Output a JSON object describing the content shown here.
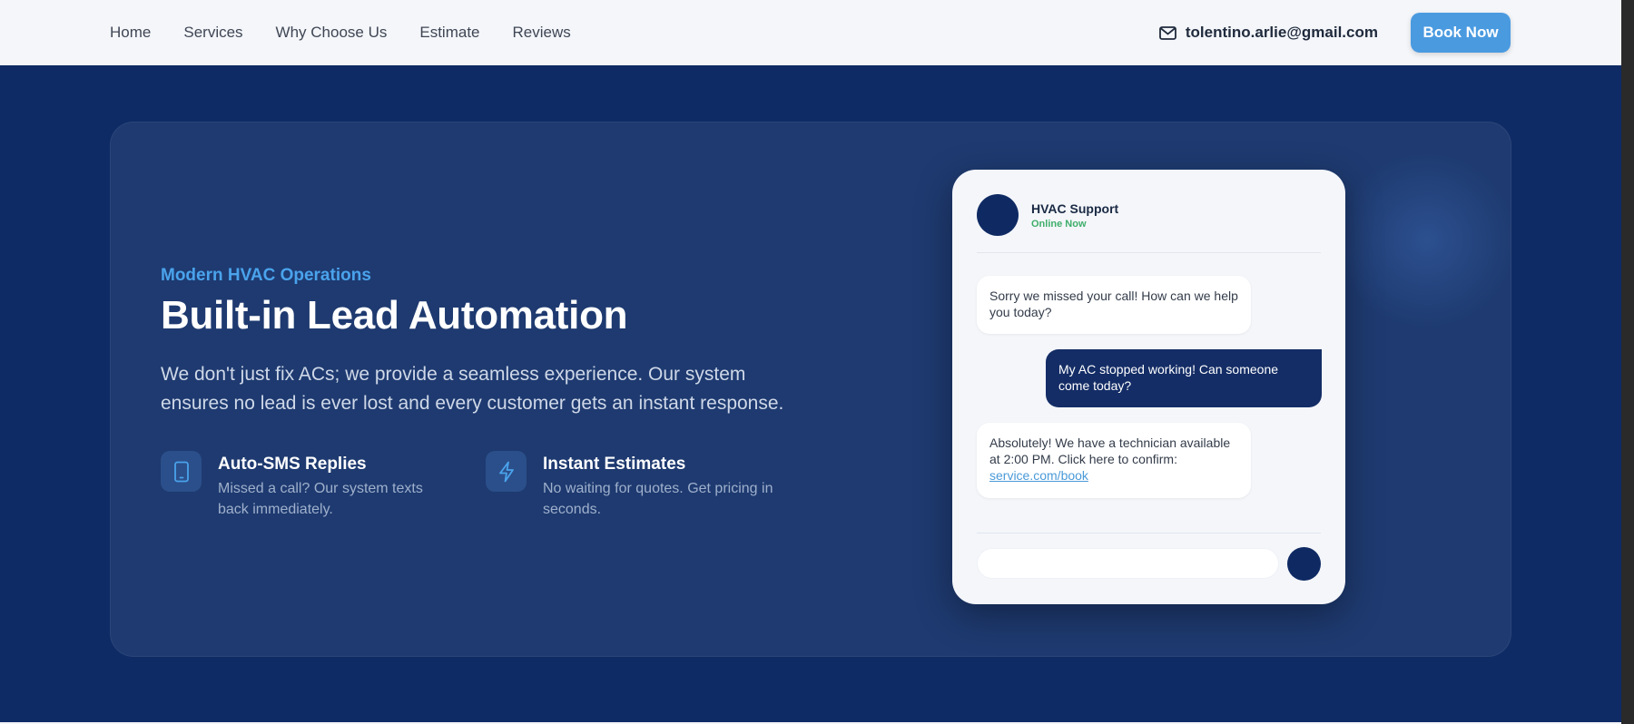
{
  "nav": {
    "links": [
      "Home",
      "Services",
      "Why Choose Us",
      "Estimate",
      "Reviews"
    ],
    "email": "tolentino.arlie@gmail.com",
    "book_label": "Book Now"
  },
  "hero": {
    "eyebrow": "Modern HVAC Operations",
    "headline": "Built-in Lead Automation",
    "description": "We don't just fix ACs; we provide a seamless experience. Our system ensures no lead is ever lost and every customer gets an instant response.",
    "features": [
      {
        "icon": "smartphone-icon",
        "title": "Auto-SMS Replies",
        "text": "Missed a call? Our system texts back immediately."
      },
      {
        "icon": "lightning-icon",
        "title": "Instant Estimates",
        "text": "No waiting for quotes. Get pricing in seconds."
      }
    ]
  },
  "chat": {
    "agent_name": "HVAC Support",
    "agent_status": "Online Now",
    "messages": [
      {
        "from": "agent",
        "text": "Sorry we missed your call! How can we help you today?"
      },
      {
        "from": "customer",
        "text": "My AC stopped working! Can someone come today?"
      },
      {
        "from": "agent",
        "text": "Absolutely! We have a technician available at 2:00 PM. Click here to confirm:",
        "link": "service.com/book"
      }
    ]
  },
  "colors": {
    "page_bg": "#0f2b66",
    "card_bg": "#1e3a70",
    "accent": "#4aa3ec",
    "button": "#4a9ae0",
    "navy": "#0f2a63",
    "online": "#3fae6a"
  }
}
